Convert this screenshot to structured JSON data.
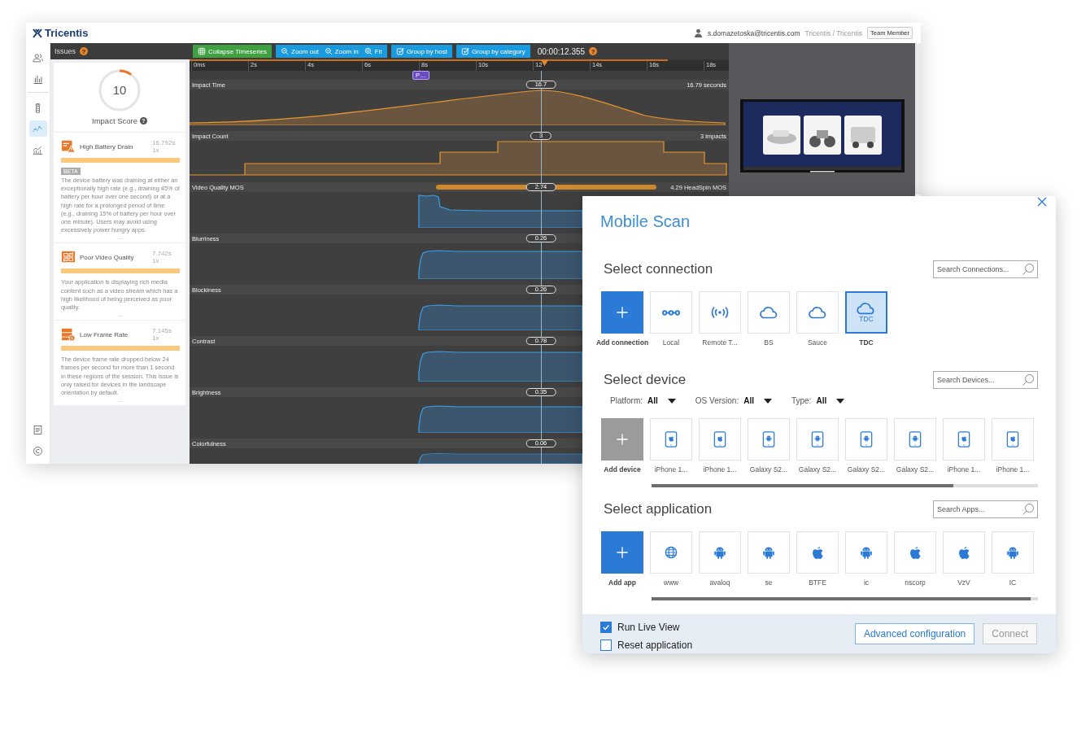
{
  "header": {
    "logo": "Tricentis",
    "email": "s.domazetoska@tricentis.com",
    "org": "Tricentis / Tricentis",
    "role": "Team Member"
  },
  "rail": {
    "top": [
      {
        "kind": "users",
        "selected": false
      },
      {
        "kind": "bars",
        "selected": false
      },
      {
        "kind": "tower",
        "selected": false
      },
      {
        "kind": "trend",
        "selected": true
      },
      {
        "kind": "area",
        "selected": false
      }
    ],
    "bottom": [
      {
        "kind": "document",
        "selected": false
      },
      {
        "kind": "copyright",
        "selected": false
      }
    ]
  },
  "issues": {
    "title": "Issues",
    "help": "?",
    "score": "10",
    "level": 0.1,
    "score_label": "Impact Score",
    "score_help": "?",
    "items": [
      {
        "kind": "battery",
        "title": "High Battery Drain",
        "duration": "16.792s",
        "count": "1x",
        "badge": "BETA",
        "description": "The device battery was draining at either an exceptionally high rate (e.g., draining 45% of battery per hour over one second) or at a high rate for a prolonged period of time (e.g., draining 15% of battery per hour over one minute). Users may avoid using excessively power hungry apps.",
        "more": "..."
      },
      {
        "kind": "video",
        "title": "Poor Video Quality",
        "duration": "7.742s",
        "count": "1x",
        "description": "Your application is displaying rich media content such as a video stream which has a high likelihood of being perceived as poor quality.",
        "more": "..."
      },
      {
        "kind": "frames",
        "title": "Low Frame Rate",
        "duration": "7.145s",
        "count": "1x",
        "description": "The device frame rate dropped below 24 frames per second for more than 1 second in these regions of the session. This issue is only raised for devices in the landscape orientation by default.",
        "more": "..."
      }
    ]
  },
  "toolbar": {
    "groups": [
      {
        "color": "#3fa142",
        "buttons": [
          {
            "label": "Collapse Timeseries",
            "kind": "grid"
          }
        ]
      },
      {
        "color": "#1a9be0",
        "buttons": [
          {
            "label": "Zoom out",
            "kind": "zoom"
          },
          {
            "label": "Zoom in",
            "kind": "zoom"
          },
          {
            "label": "Fit",
            "kind": "target"
          }
        ]
      },
      {
        "color": "#1a9be0",
        "buttons": [
          {
            "label": "Group by host",
            "kind": "check"
          }
        ]
      },
      {
        "color": "#1a9be0",
        "buttons": [
          {
            "label": "Group by category",
            "kind": "check"
          }
        ]
      }
    ],
    "time": "00:00:12.355",
    "help": "?"
  },
  "timeline": {
    "ticks": [
      "0ms",
      "2s",
      "4s",
      "6s",
      "8s",
      "10s",
      "12",
      "14s",
      "16s",
      "18s"
    ],
    "marker": "P…",
    "tracks": [
      {
        "kind": "impact_time",
        "label": "Impact Time",
        "value": "16.7",
        "reading": "16.79 seconds"
      },
      {
        "kind": "impact_count",
        "label": "Impact Count",
        "value": "3",
        "reading": "3 impacts"
      },
      {
        "kind": "mos",
        "label": "Video Quality MOS",
        "value": "2.74",
        "reading": "4.29 HeadSpin MOS"
      },
      {
        "kind": "quality",
        "label": "Blurriness",
        "value": "0.26"
      },
      {
        "kind": "quality",
        "label": "Blockiness",
        "value": "0.26"
      },
      {
        "kind": "quality",
        "label": "Contrast",
        "value": "0.78"
      },
      {
        "kind": "quality",
        "label": "Brightness",
        "value": "0.35"
      },
      {
        "kind": "quality",
        "label": "Colorfulness",
        "value": "0.06"
      }
    ]
  },
  "dialog": {
    "title": "Mobile Scan",
    "sections": [
      {
        "title": "Select connection",
        "placeholder": "Search Connections...",
        "add": {
          "label": "Add connection",
          "disabled": false
        },
        "items": [
          {
            "label": "Local",
            "kind": "link",
            "selected": false
          },
          {
            "label": "Remote T...",
            "kind": "broadcast",
            "selected": false
          },
          {
            "label": "BS",
            "kind": "cloud",
            "selected": false
          },
          {
            "label": "Sauce",
            "kind": "cloud",
            "selected": false
          },
          {
            "label": "TDC",
            "kind": "cloud",
            "icon_text": "TDC",
            "selected": true
          }
        ]
      },
      {
        "title": "Select device",
        "placeholder": "Search Devices...",
        "filters": [
          {
            "label": "Platform:",
            "value": "All"
          },
          {
            "label": "OS Version:",
            "value": "All"
          },
          {
            "label": "Type:",
            "value": "All"
          }
        ],
        "add": {
          "label": "Add device",
          "disabled": true
        },
        "items": [
          {
            "label": "iPhone 1...",
            "kind": "phone-apple",
            "selected": false
          },
          {
            "label": "iPhone 1...",
            "kind": "phone-apple",
            "selected": false
          },
          {
            "label": "Galaxy S2...",
            "kind": "phone-android",
            "selected": false
          },
          {
            "label": "Galaxy S2...",
            "kind": "phone-android",
            "selected": false
          },
          {
            "label": "Galaxy S2...",
            "kind": "phone-android",
            "selected": false
          },
          {
            "label": "Galaxy S2...",
            "kind": "phone-android",
            "selected": false
          },
          {
            "label": "iPhone 1...",
            "kind": "phone-apple",
            "selected": false
          },
          {
            "label": "iPhone 1...",
            "kind": "phone-apple",
            "selected": false
          }
        ]
      },
      {
        "title": "Select application",
        "placeholder": "Search Apps...",
        "add": {
          "label": "Add app",
          "disabled": false
        },
        "items": [
          {
            "label": "www",
            "kind": "globe",
            "selected": false
          },
          {
            "label": "avaloq",
            "kind": "android",
            "selected": false
          },
          {
            "label": "se",
            "kind": "android",
            "selected": false
          },
          {
            "label": "BTFE",
            "kind": "apple",
            "selected": false
          },
          {
            "label": "ic",
            "kind": "android",
            "selected": false
          },
          {
            "label": "nscorp",
            "kind": "apple",
            "selected": false
          },
          {
            "label": "VzV",
            "kind": "apple",
            "selected": false
          },
          {
            "label": "IC",
            "kind": "android",
            "selected": false
          }
        ]
      }
    ],
    "options": [
      {
        "label": "Run Live View",
        "checked": true
      },
      {
        "label": "Reset application",
        "checked": false
      }
    ],
    "buttons": [
      {
        "label": "Advanced configuration",
        "disabled": false
      },
      {
        "label": "Connect",
        "disabled": true
      }
    ]
  }
}
